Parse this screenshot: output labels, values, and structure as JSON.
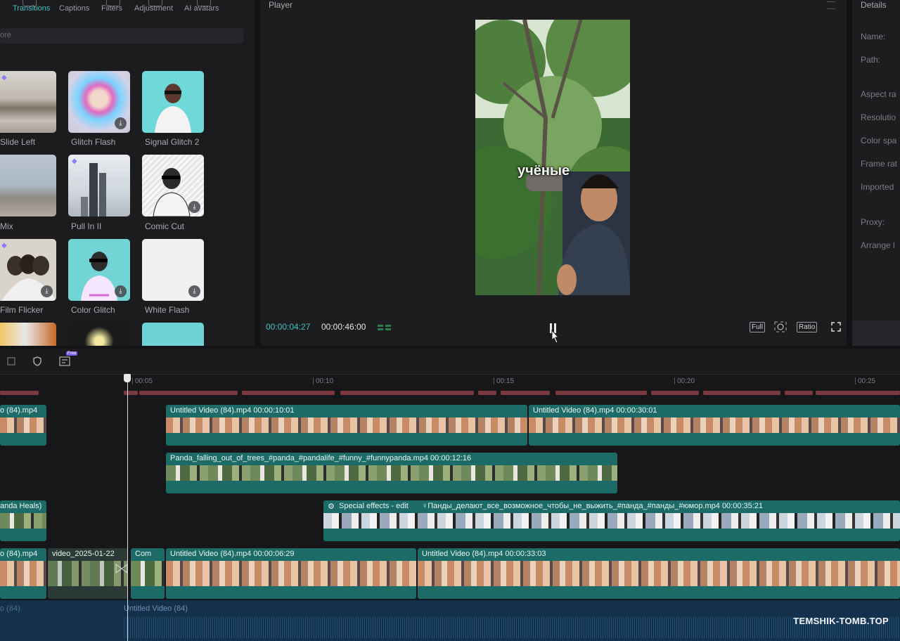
{
  "left_panel": {
    "tabs": [
      {
        "label": "Transitions",
        "active": true
      },
      {
        "label": "Captions"
      },
      {
        "label": "Filters"
      },
      {
        "label": "Adjustment"
      },
      {
        "label": "AI avatars"
      }
    ],
    "search_placeholder": "ore",
    "items": [
      {
        "label": "Slide Left",
        "premium": true
      },
      {
        "label": "Glitch Flash",
        "download": true
      },
      {
        "label": "Signal Glitch 2"
      },
      {
        "label": "Mix"
      },
      {
        "label": "Pull In II",
        "premium": true
      },
      {
        "label": "Comic Cut",
        "download": true
      },
      {
        "label": "Film Flicker",
        "premium": true,
        "download": true
      },
      {
        "label": "Color Glitch",
        "download": true
      },
      {
        "label": "White Flash",
        "download": true
      }
    ],
    "download_glyph": "⤓",
    "premium_glyph": "◆"
  },
  "player": {
    "title": "Player",
    "caption": "учёные",
    "current_time": "00:00:04:27",
    "total_time": "00:00:46:00",
    "controls": {
      "full": "Full",
      "ratio": "Ratio"
    }
  },
  "details": {
    "title": "Details",
    "labels": [
      "Name:",
      "Path:",
      "Aspect ra",
      "Resolutio",
      "Color spa",
      "Frame rat",
      "Imported",
      "Proxy:",
      "Arrange l"
    ]
  },
  "timeline": {
    "toolbar_badge": "Free",
    "ruler": [
      "00:05",
      "00:10",
      "00:15",
      "00:20",
      "00:25"
    ],
    "tracks": {
      "track1": [
        {
          "label": "o (84).mp4"
        },
        {
          "label": "Untitled Video (84).mp4   00:00:10:01"
        },
        {
          "label": "Untitled Video (84).mp4   00:00:30:01"
        }
      ],
      "track2": [
        {
          "label": "Panda_falling_out_of_trees_#panda_#pandalife_#funny_#funnypanda.mp4   00:00:12:16"
        }
      ],
      "track3": [
        {
          "label": "anda Heals)"
        },
        {
          "label": "Special effects - edit"
        },
        {
          "label": "♀Панды_делают_все_возможное_чтобы_не_выжить_#панда_#панды_#юмор.mp4   00:00:35:21"
        }
      ],
      "track4": [
        {
          "label": "o (84).mp4"
        },
        {
          "label": "video_2025-01-22"
        },
        {
          "label": "Com"
        },
        {
          "label": "Untitled Video (84).mp4   00:00:06:29"
        },
        {
          "label": "Untitled Video (84).mp4   00:00:33:03"
        }
      ],
      "audio": {
        "label": "Untitled Video (84)",
        "left_label": "o (84)"
      }
    }
  },
  "watermark": "TEMSHIK-TOMB.TOP",
  "colors": {
    "accent": "#3fc4c1",
    "clip": "#1d6b66",
    "audio": "#13314d"
  }
}
